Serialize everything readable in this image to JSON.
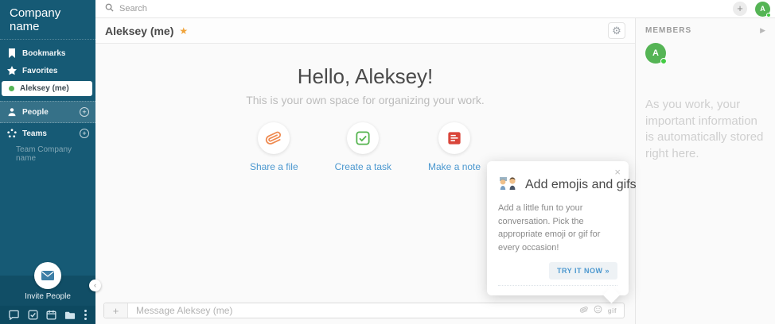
{
  "sidebar": {
    "title": "Company name",
    "items": [
      {
        "label": "Bookmarks"
      },
      {
        "label": "Favorites"
      },
      {
        "label": "Aleksey (me)"
      },
      {
        "label": "People"
      },
      {
        "label": "Teams"
      },
      {
        "label": "Team Company name"
      }
    ],
    "invite_label": "Invite People"
  },
  "topbar": {
    "search_placeholder": "Search",
    "add_label": "+",
    "avatar_initial": "A"
  },
  "content": {
    "header_title": "Aleksey (me)",
    "star": "★",
    "gear": "⚙",
    "hero_title": "Hello, Aleksey!",
    "hero_subtitle": "This is your own space for organizing your work.",
    "actions": [
      {
        "label": "Share a file"
      },
      {
        "label": "Create a task"
      },
      {
        "label": "Make a note"
      }
    ],
    "composer_placeholder": "Message Aleksey (me)",
    "composer_plus": "+",
    "gif_label": "gif"
  },
  "members_panel": {
    "header": "MEMBERS",
    "collapse_arrow": "▶",
    "avatar_initial": "A",
    "hint": "As you work, your important information is automatically stored right here."
  },
  "popup": {
    "title": "Add emojis and gifs",
    "body": "Add a little fun to your conversation. Pick the appropriate emoji or gif for every occasion!",
    "button_label": "TRY IT NOW »",
    "close_label": "×"
  },
  "colors": {
    "sidebar_bg": "#165a75",
    "sidebar_dark_band": "#114e66",
    "taskbar_bg": "#0d4960",
    "avatar_green": "#55b455",
    "presence_green": "#44cc44",
    "star_orange": "#f0a33a",
    "link_blue": "#4a97cf",
    "paperclip_orange": "#ef8a50",
    "task_green": "#55b44f",
    "note_red": "#d9453a"
  }
}
